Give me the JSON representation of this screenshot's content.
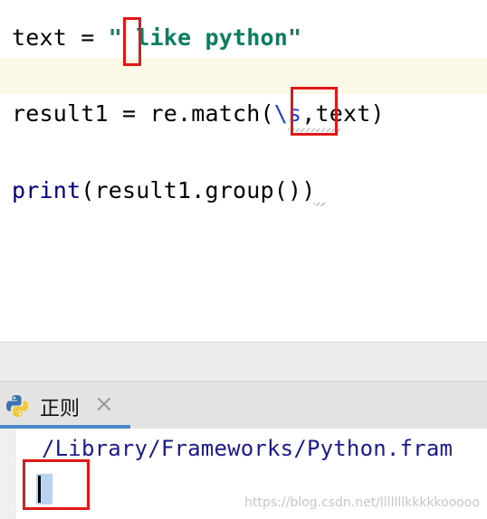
{
  "editor": {
    "line1": {
      "var": "text",
      "op": " = ",
      "string": "\" like python\""
    },
    "line3": {
      "prefix": "result1 = re.match(",
      "regex": "\\s",
      "suffix": ",text)"
    },
    "line5": {
      "func": "print",
      "args": "(result1.group())"
    }
  },
  "run_panel": {
    "tab_label": "正则",
    "close_icon": "×",
    "console_path": "/Library/Frameworks/Python.fram",
    "output": ""
  },
  "watermark": "https://blog.csdn.net/lllllllkkkkkooooo",
  "colors": {
    "annotation": "#e01818",
    "tab_underline": "#4a87c8",
    "string": "#0a7d63",
    "regex": "#1c3fd6"
  }
}
